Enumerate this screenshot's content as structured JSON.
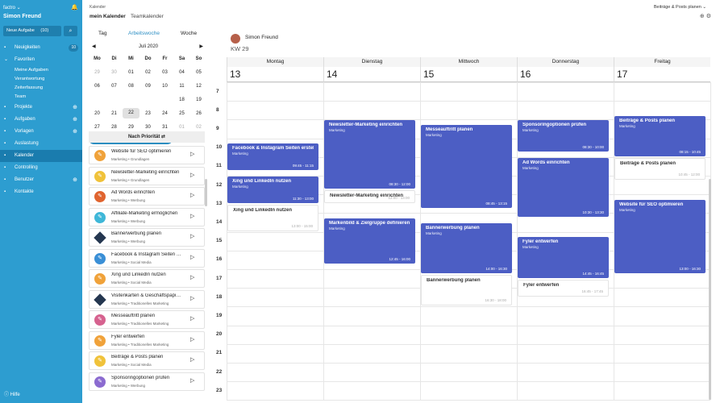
{
  "sidebar": {
    "workspace": "factro ⌄",
    "user": "Simon Freund",
    "new_task_label": "Neue Aufgabe",
    "new_task_count": "(10)",
    "items": [
      {
        "label": "Neuigkeiten",
        "icon": "news-icon",
        "badge": "10"
      },
      {
        "label": "Favoriten",
        "icon": "chevron-down-icon"
      },
      {
        "label": "Projekte",
        "icon": "folder-icon",
        "plus": "⊕"
      },
      {
        "label": "Aufgaben",
        "icon": "task-icon",
        "plus": "⊕"
      },
      {
        "label": "Vorlagen",
        "icon": "template-icon",
        "plus": "⊕"
      },
      {
        "label": "Auslastung",
        "icon": "chart-icon"
      },
      {
        "label": "Kalender",
        "icon": "calendar-icon"
      },
      {
        "label": "Controlling",
        "icon": "controlling-icon"
      },
      {
        "label": "Benutzer",
        "icon": "user-icon",
        "plus": "⊕"
      },
      {
        "label": "Kontakte",
        "icon": "contacts-icon"
      }
    ],
    "favorites": [
      "Meine Aufgaben",
      "Verantwortung",
      "Zeiterfassung",
      "Team"
    ],
    "help": "Hilfe"
  },
  "header": {
    "breadcrumb": "Kalender",
    "tab_mine": "mein Kalender",
    "tab_team": "Teamkalender",
    "right_label": "Beiträge & Posts planen"
  },
  "view_tabs": [
    "Tag",
    "Arbeitswoche",
    "Woche"
  ],
  "minical": {
    "month": "Juli 2020",
    "dow": [
      "Mo",
      "Di",
      "Mi",
      "Do",
      "Fr",
      "Sa",
      "So"
    ],
    "weeks": [
      [
        "29",
        "30",
        "01",
        "02",
        "03",
        "04",
        "05"
      ],
      [
        "06",
        "07",
        "08",
        "09",
        "10",
        "11",
        "12"
      ],
      [
        "13",
        "14",
        "15",
        "16",
        "17",
        "18",
        "19"
      ],
      [
        "20",
        "21",
        "22",
        "23",
        "24",
        "25",
        "26"
      ],
      [
        "27",
        "28",
        "29",
        "30",
        "31",
        "01",
        "02"
      ]
    ]
  },
  "priority_label": "Nach Priorität ⇄",
  "tasks": [
    {
      "title": "Website für SEO optimieren",
      "sub": "Marketing • Grundlagen",
      "color": "#f0a23a",
      "shape": "circle"
    },
    {
      "title": "Newsletter-Marketing einrichten",
      "sub": "Marketing • Grundlagen",
      "color": "#f0c23a",
      "shape": "circle"
    },
    {
      "title": "Ad Words einrichten",
      "sub": "Marketing • Werbung",
      "color": "#e0642f",
      "shape": "circle"
    },
    {
      "title": "Affiliate-Marketing ermöglichen",
      "sub": "Marketing • Werbung",
      "color": "#3fb7d8",
      "shape": "circle"
    },
    {
      "title": "Bannerwerbung planen",
      "sub": "Marketing • Werbung",
      "color": "#253750",
      "shape": "diamond"
    },
    {
      "title": "Facebook & Instagram Seiten erstellen",
      "sub": "Marketing • Social Media",
      "color": "#3a8fd6",
      "shape": "circle"
    },
    {
      "title": "Xing und LinkedIn nutzen",
      "sub": "Marketing • Social Media",
      "color": "#f0a23a",
      "shape": "circle"
    },
    {
      "title": "Visitenkarten & Geschäftspapiere",
      "sub": "Marketing • Traditionelles Marketing",
      "color": "#253750",
      "shape": "diamond"
    },
    {
      "title": "Messeauftritt planen",
      "sub": "Marketing • Traditionelles Marketing",
      "color": "#d6628f",
      "shape": "circle"
    },
    {
      "title": "Fyler entwerfen",
      "sub": "Marketing • Traditionelles Marketing",
      "color": "#f0a23a",
      "shape": "circle"
    },
    {
      "title": "Beiträge & Posts planen",
      "sub": "Marketing • Social Media",
      "color": "#f0c23a",
      "shape": "circle"
    },
    {
      "title": "Sponsoringoptionen prüfen",
      "sub": "Marketing • Werbung",
      "color": "#8b6bd0",
      "shape": "circle"
    }
  ],
  "calendar": {
    "person": "Simon Freund",
    "week": "KW 29",
    "days": [
      "Montag",
      "Dienstag",
      "Mittwoch",
      "Donnerstag",
      "Freitag"
    ],
    "day_numbers": [
      "13",
      "14",
      "15",
      "16",
      "17"
    ],
    "hours": [
      "7",
      "8",
      "9",
      "10",
      "11",
      "12",
      "13",
      "14",
      "15",
      "16",
      "17",
      "18",
      "19",
      "20",
      "21",
      "22",
      "23"
    ],
    "events": [
      {
        "day": 0,
        "start": 9.75,
        "end": 11.25,
        "title": "Facebook & Instagram Seiten erstellen",
        "sub": "Marketing",
        "time": "09:45 - 11:15",
        "style": "solid"
      },
      {
        "day": 0,
        "start": 11.5,
        "end": 13.0,
        "title": "Xing und LinkedIn nutzen",
        "sub": "Marketing",
        "time": "11:30 - 13:00",
        "style": "solid"
      },
      {
        "day": 0,
        "start": 13.0,
        "end": 14.5,
        "title": "Xing und LinkedIn nutzen",
        "sub": "Marketing",
        "time": "13:00 - 15:00",
        "style": "light"
      },
      {
        "day": 1,
        "start": 8.5,
        "end": 12.25,
        "title": "Newsletter-Marketing einrichten",
        "sub": "Marketing",
        "time": "08:30 - 12:00",
        "style": "solid"
      },
      {
        "day": 1,
        "start": 12.25,
        "end": 13.0,
        "title": "Newsletter-Marketing einrichten",
        "sub": "Marketing",
        "time": "12:00 - 13:00",
        "style": "light"
      },
      {
        "day": 1,
        "start": 13.75,
        "end": 16.25,
        "title": "Markenbild & Zielgruppe definieren",
        "sub": "Marketing",
        "time": "12:45 - 16:00",
        "style": "solid"
      },
      {
        "day": 2,
        "start": 8.75,
        "end": 13.25,
        "title": "Messeauftritt planen",
        "sub": "Marketing",
        "time": "08:45 - 13:15",
        "style": "solid"
      },
      {
        "day": 2,
        "start": 14.0,
        "end": 16.75,
        "title": "Bannerwerbung planen",
        "sub": "Marketing",
        "time": "14:00 - 16:30",
        "style": "solid"
      },
      {
        "day": 2,
        "start": 16.75,
        "end": 18.5,
        "title": "Bannerwerbung planen",
        "sub": "Marketing",
        "time": "16:30 - 18:00",
        "style": "light"
      },
      {
        "day": 3,
        "start": 8.5,
        "end": 10.25,
        "title": "Sponsoringoptionen prüfen",
        "sub": "Marketing",
        "time": "08:30 - 10:00",
        "style": "solid"
      },
      {
        "day": 3,
        "start": 10.5,
        "end": 13.75,
        "title": "Ad Words einrichten",
        "sub": "Marketing",
        "time": "10:30 - 13:30",
        "style": "solid"
      },
      {
        "day": 3,
        "start": 14.75,
        "end": 17.0,
        "title": "Fyler entwerfen",
        "sub": "Marketing",
        "time": "14:45 - 16:45",
        "style": "solid"
      },
      {
        "day": 3,
        "start": 17.0,
        "end": 18.0,
        "title": "Fyler entwerfen",
        "sub": "Marketing",
        "time": "16:45 - 17:45",
        "style": "light"
      },
      {
        "day": 4,
        "start": 8.25,
        "end": 10.5,
        "title": "Beiträge & Posts planen",
        "sub": "Marketing",
        "time": "08:15 - 10:45",
        "style": "solid"
      },
      {
        "day": 4,
        "start": 10.5,
        "end": 11.75,
        "title": "Beiträge & Posts planen",
        "sub": "Marketing",
        "time": "10:45 - 12:00",
        "style": "light"
      },
      {
        "day": 4,
        "start": 12.75,
        "end": 16.75,
        "title": "Website für SEO optimieren",
        "sub": "Marketing",
        "time": "13:00 - 16:30",
        "style": "solid"
      }
    ]
  }
}
